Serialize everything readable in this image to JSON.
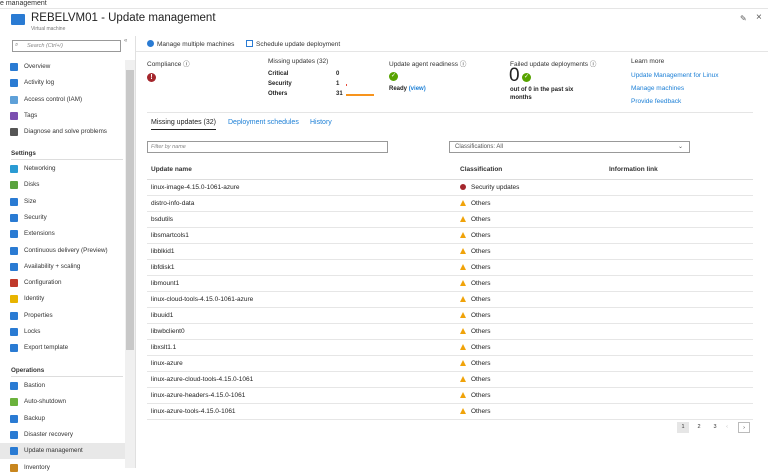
{
  "top_strip": "e management",
  "header": {
    "title": "REBELVM01 - Update management",
    "subtitle": "Virtual machine"
  },
  "sidebar": {
    "search_placeholder": "Search (Ctrl+/)",
    "items": [
      {
        "label": "Overview",
        "color": "#2a7bd3"
      },
      {
        "label": "Activity log",
        "color": "#2a7bd3"
      },
      {
        "label": "Access control (IAM)",
        "color": "#5ea0d8"
      },
      {
        "label": "Tags",
        "color": "#7b4fb0"
      },
      {
        "label": "Diagnose and solve problems",
        "color": "#555555"
      }
    ],
    "settings_header": "Settings",
    "settings": [
      {
        "label": "Networking",
        "color": "#2a9bd3"
      },
      {
        "label": "Disks",
        "color": "#5aa33f"
      },
      {
        "label": "Size",
        "color": "#2a7bd3"
      },
      {
        "label": "Security",
        "color": "#2a7bd3"
      },
      {
        "label": "Extensions",
        "color": "#2a7bd3"
      },
      {
        "label": "Continuous delivery (Preview)",
        "color": "#2a7bd3"
      },
      {
        "label": "Availability + scaling",
        "color": "#2a7bd3"
      },
      {
        "label": "Configuration",
        "color": "#c0392b"
      },
      {
        "label": "Identity",
        "color": "#e8b400"
      },
      {
        "label": "Properties",
        "color": "#2a7bd3"
      },
      {
        "label": "Locks",
        "color": "#2a7bd3"
      },
      {
        "label": "Export template",
        "color": "#2a7bd3"
      }
    ],
    "operations_header": "Operations",
    "operations": [
      {
        "label": "Bastion",
        "color": "#2a7bd3"
      },
      {
        "label": "Auto-shutdown",
        "color": "#6bb23c"
      },
      {
        "label": "Backup",
        "color": "#2a7bd3"
      },
      {
        "label": "Disaster recovery",
        "color": "#2a7bd3"
      },
      {
        "label": "Update management",
        "color": "#2a7bd3",
        "selected": true
      },
      {
        "label": "Inventory",
        "color": "#c8861e"
      }
    ]
  },
  "toolbar": {
    "manage": "Manage multiple machines",
    "schedule": "Schedule update deployment"
  },
  "summary": {
    "compliance": "Compliance",
    "missing_title": "Missing updates (32)",
    "missing": [
      {
        "label": "Critical",
        "count": "0",
        "value": 0
      },
      {
        "label": "Security",
        "count": "1",
        "value": 1
      },
      {
        "label": "Others",
        "count": "31",
        "value": 31
      }
    ],
    "agent_title": "Update agent readiness",
    "agent_status": "Ready",
    "agent_view": "(view)",
    "failed_title": "Failed update deployments",
    "failed_count": "0",
    "failed_desc": "out of 0 in the past six months",
    "learn_title": "Learn more",
    "links": [
      "Update Management for Linux",
      "Manage machines",
      "Provide feedback"
    ]
  },
  "tabs": [
    "Missing updates (32)",
    "Deployment schedules",
    "History"
  ],
  "filter_placeholder": "Filter by name",
  "classifications": "Classifications: All",
  "table": {
    "headers": [
      "Update name",
      "Classification",
      "Information link"
    ],
    "rows": [
      [
        "linux-image-4.15.0-1061-azure",
        "Security updates"
      ],
      [
        "distro-info-data",
        "Others"
      ],
      [
        "bsdutils",
        "Others"
      ],
      [
        "libsmartcols1",
        "Others"
      ],
      [
        "libblkid1",
        "Others"
      ],
      [
        "libfdisk1",
        "Others"
      ],
      [
        "libmount1",
        "Others"
      ],
      [
        "linux-cloud-tools-4.15.0-1061-azure",
        "Others"
      ],
      [
        "libuuid1",
        "Others"
      ],
      [
        "libwbclient0",
        "Others"
      ],
      [
        "libxslt1.1",
        "Others"
      ],
      [
        "linux-azure",
        "Others"
      ],
      [
        "linux-azure-cloud-tools-4.15.0-1061",
        "Others"
      ],
      [
        "linux-azure-headers-4.15.0-1061",
        "Others"
      ],
      [
        "linux-azure-tools-4.15.0-1061",
        "Others"
      ]
    ]
  },
  "pagination": {
    "pages": [
      "1",
      "2",
      "3"
    ],
    "current": "1"
  }
}
